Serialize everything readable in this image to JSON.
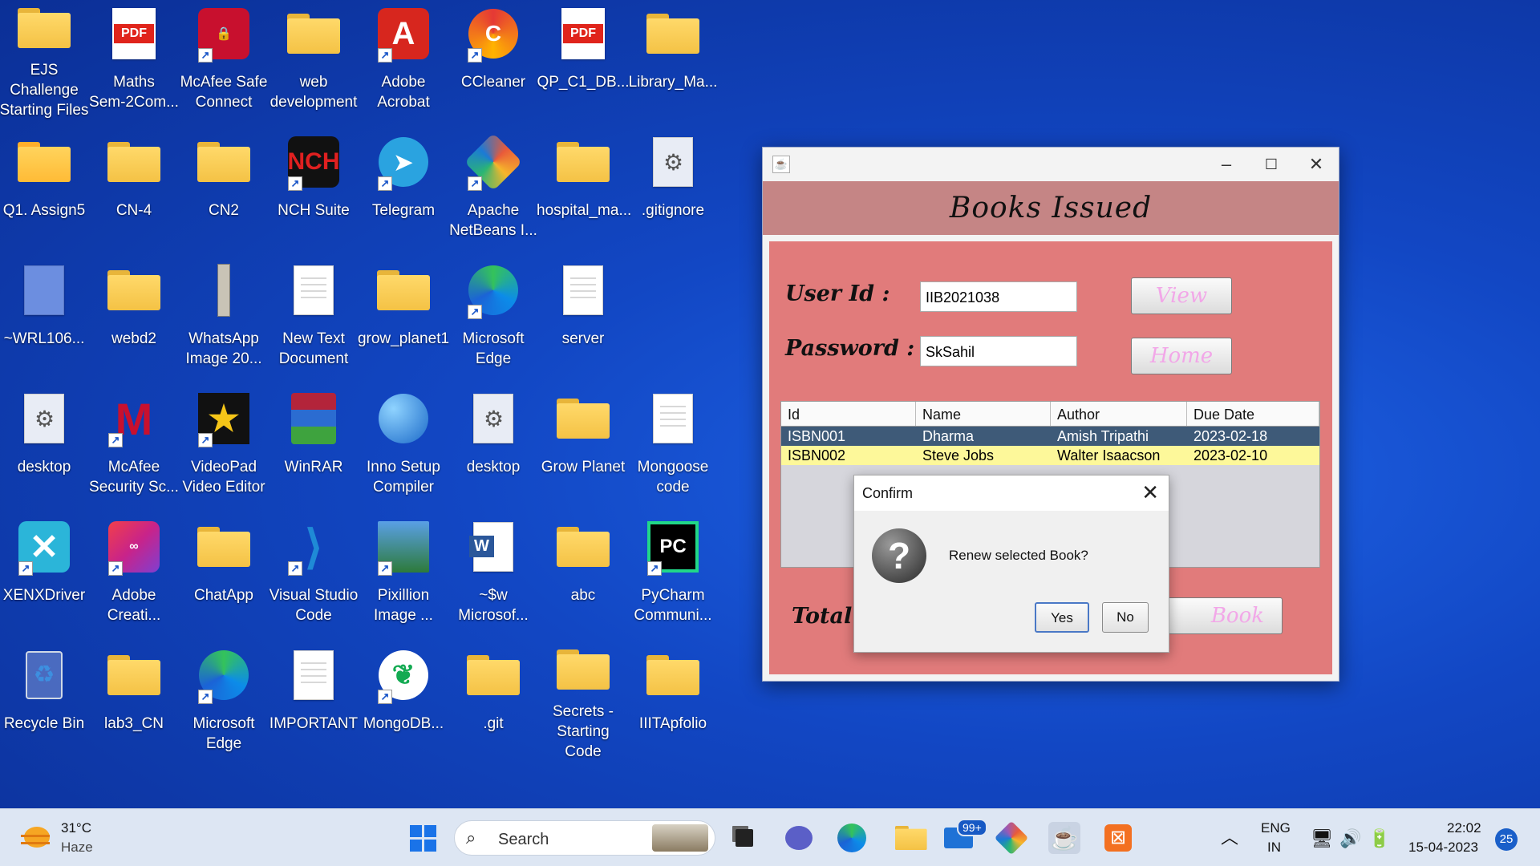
{
  "desktop": {
    "icons": [
      {
        "label": "EJS Challenge\nStarting Files",
        "icon": "folder-icon"
      },
      {
        "label": "Maths\nSem-2Com...",
        "icon": "pdf-icon"
      },
      {
        "label": "McAfee Safe\nConnect",
        "icon": "mcafee-safe-icon"
      },
      {
        "label": "web\ndevelopment",
        "icon": "folder-icon"
      },
      {
        "label": "Adobe\nAcrobat",
        "icon": "acrobat-icon"
      },
      {
        "label": "CCleaner",
        "icon": "ccleaner-icon"
      },
      {
        "label": "QP_C1_DB...",
        "icon": "pdf-icon"
      },
      {
        "label": "Library_Ma...",
        "icon": "folder-icon"
      },
      {
        "label": "Q1. Assign5",
        "icon": "zip-folder-icon"
      },
      {
        "label": "CN-4",
        "icon": "folder-icon"
      },
      {
        "label": "CN2",
        "icon": "folder-icon"
      },
      {
        "label": "NCH Suite",
        "icon": "nch-icon"
      },
      {
        "label": "Telegram",
        "icon": "telegram-icon"
      },
      {
        "label": "Apache\nNetBeans I...",
        "icon": "netbeans-icon"
      },
      {
        "label": "hospital_ma...",
        "icon": "folder-icon"
      },
      {
        "label": ".gitignore",
        "icon": "settings-file-icon"
      },
      {
        "label": "~WRL106...",
        "icon": "file-icon"
      },
      {
        "label": "webd2",
        "icon": "folder-icon"
      },
      {
        "label": "WhatsApp\nImage 20...",
        "icon": "image-icon"
      },
      {
        "label": "New Text\nDocument",
        "icon": "text-file-icon"
      },
      {
        "label": "grow_planet1",
        "icon": "folder-icon"
      },
      {
        "label": "Microsoft\nEdge",
        "icon": "edge-icon"
      },
      {
        "label": "server",
        "icon": "text-file-icon"
      },
      {
        "label": "desktop",
        "icon": "settings-file-icon"
      },
      {
        "label": "McAfee\nSecurity Sc...",
        "icon": "mcafee-icon"
      },
      {
        "label": "VideoPad\nVideo Editor",
        "icon": "videopad-icon"
      },
      {
        "label": "WinRAR",
        "icon": "winrar-icon"
      },
      {
        "label": "Inno Setup\nCompiler",
        "icon": "inno-setup-icon"
      },
      {
        "label": "desktop",
        "icon": "settings-file-icon"
      },
      {
        "label": "Grow Planet",
        "icon": "folder-icon"
      },
      {
        "label": "Mongoose\ncode",
        "icon": "text-file-icon"
      },
      {
        "label": "XENXDriver",
        "icon": "xenx-icon"
      },
      {
        "label": "Adobe\nCreati...",
        "icon": "creative-cloud-icon"
      },
      {
        "label": "ChatApp",
        "icon": "folder-icon"
      },
      {
        "label": "Visual Studio\nCode",
        "icon": "vscode-icon"
      },
      {
        "label": "Pixillion\nImage ...",
        "icon": "pixillion-icon"
      },
      {
        "label": "~$w\nMicrosof...",
        "icon": "word-icon"
      },
      {
        "label": "abc",
        "icon": "folder-icon"
      },
      {
        "label": "PyCharm\nCommuni...",
        "icon": "pycharm-icon"
      },
      {
        "label": "Recycle Bin",
        "icon": "recycle-bin-icon"
      },
      {
        "label": "lab3_CN",
        "icon": "folder-icon"
      },
      {
        "label": "Microsoft\nEdge",
        "icon": "edge-icon"
      },
      {
        "label": "IMPORTANT",
        "icon": "text-file-icon"
      },
      {
        "label": "MongoDB...",
        "icon": "mongodb-icon"
      },
      {
        "label": ".git",
        "icon": "folder-icon"
      },
      {
        "label": "Secrets -\nStarting Code",
        "icon": "folder-icon"
      },
      {
        "label": "IIITApfolio",
        "icon": "folder-icon"
      }
    ]
  },
  "window": {
    "title": "Books Issued",
    "user_id_label": "User Id :",
    "user_id_value": "IIB2021038",
    "password_label": "Password :",
    "password_value": "SkSahil",
    "view_button": "View",
    "home_button": "Home",
    "total_label": "Total",
    "book_button": "Book",
    "table": {
      "columns": [
        "Id",
        "Name",
        "Author",
        "Due Date"
      ],
      "rows": [
        [
          "ISBN001",
          "Dharma",
          "Amish Tripathi",
          "2023-02-18"
        ],
        [
          "ISBN002",
          "Steve Jobs",
          "Walter Isaacson",
          "2023-02-10"
        ]
      ]
    }
  },
  "dialog": {
    "title": "Confirm",
    "message": "Renew selected Book?",
    "yes_label": "Yes",
    "no_label": "No"
  },
  "taskbar": {
    "weather_temp": "31°C",
    "weather_desc": "Haze",
    "search_placeholder": "Search",
    "mail_badge": "99+",
    "lang_top": "ENG",
    "lang_bottom": "IN",
    "time": "22:02",
    "date": "15-04-2023",
    "notification_count": "25"
  }
}
